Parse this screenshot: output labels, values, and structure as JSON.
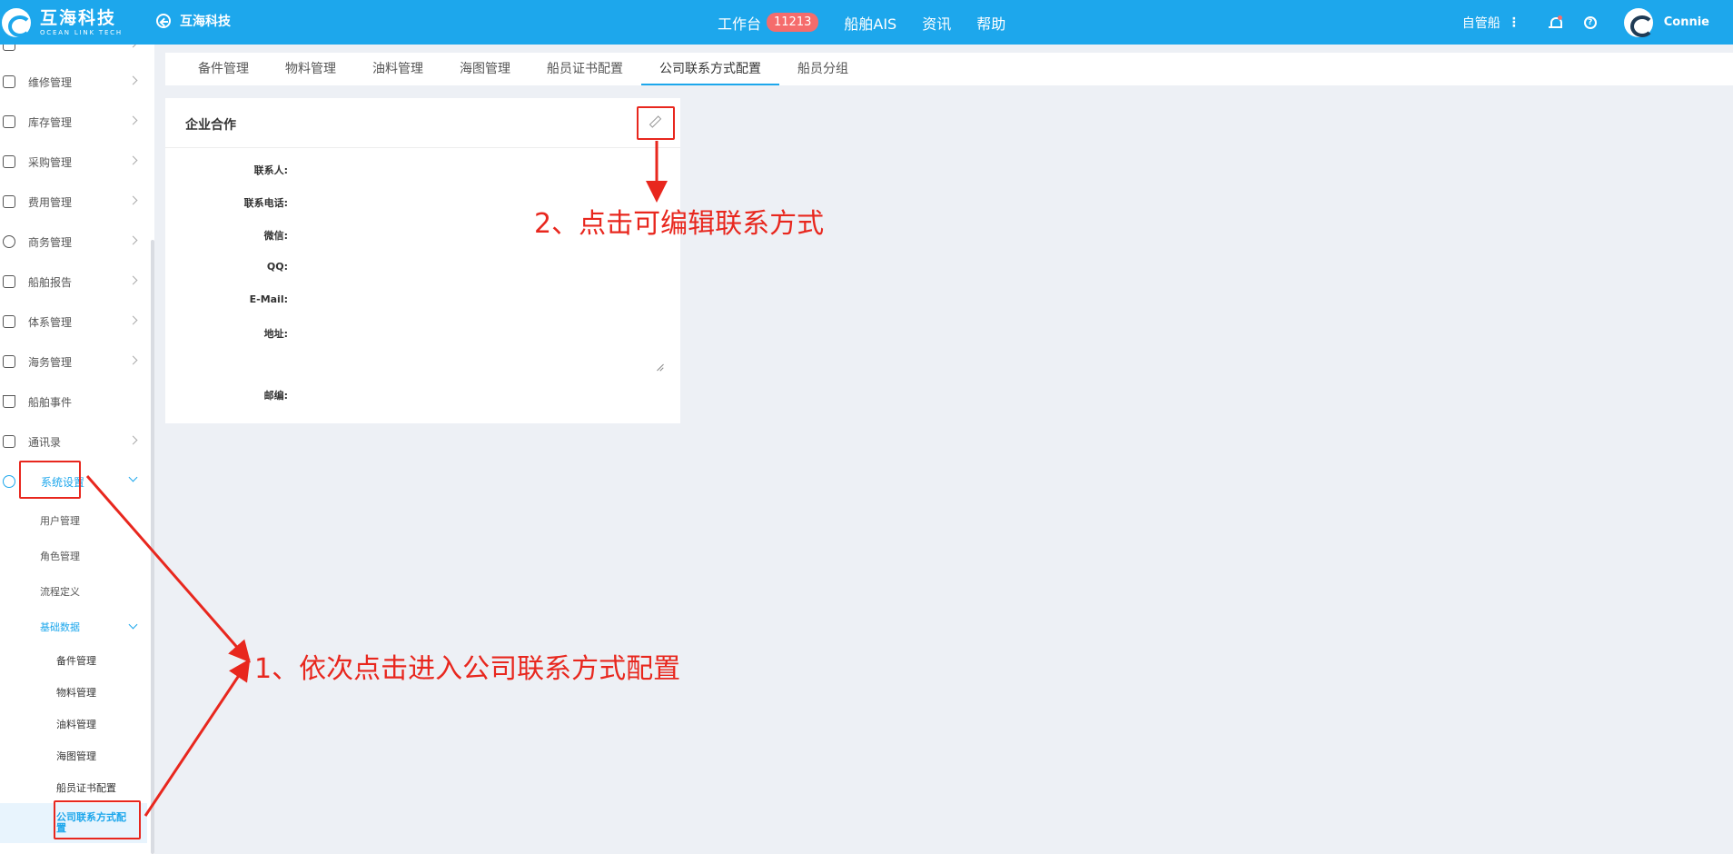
{
  "header": {
    "logo_cn": "互海科技",
    "logo_en": "OCEAN LINK TECH",
    "back_label": "互海科技",
    "nav": [
      {
        "label": "工作台",
        "badge": "11213"
      },
      {
        "label": "船舶AIS"
      },
      {
        "label": "资讯"
      },
      {
        "label": "帮助"
      }
    ],
    "ship_label": "自管船",
    "username": "Connie",
    "accent_color": "#1da7ec"
  },
  "sidebar": {
    "items": [
      {
        "label": "维修管理",
        "icon": "wrench-icon"
      },
      {
        "label": "库存管理",
        "icon": "home-icon"
      },
      {
        "label": "采购管理",
        "icon": "cart-icon"
      },
      {
        "label": "费用管理",
        "icon": "database-icon"
      },
      {
        "label": "商务管理",
        "icon": "globe-icon"
      },
      {
        "label": "船舶报告",
        "icon": "calendar-icon"
      },
      {
        "label": "体系管理",
        "icon": "copy-icon"
      },
      {
        "label": "海务管理",
        "icon": "signpost-icon"
      },
      {
        "label": "船舶事件",
        "icon": "warning-icon"
      },
      {
        "label": "通讯录",
        "icon": "address-book-icon"
      },
      {
        "label": "系统设置",
        "icon": "gear-icon"
      }
    ],
    "system_settings_children": [
      "用户管理",
      "角色管理",
      "流程定义",
      "基础数据"
    ],
    "basic_data_children": [
      "备件管理",
      "物料管理",
      "油料管理",
      "海图管理",
      "船员证书配置",
      "公司联系方式配置"
    ]
  },
  "tabs": [
    "备件管理",
    "物料管理",
    "油料管理",
    "海图管理",
    "船员证书配置",
    "公司联系方式配置",
    "船员分组"
  ],
  "active_tab": "公司联系方式配置",
  "card": {
    "title": "企业合作",
    "fields": [
      "联系人:",
      "联系电话:",
      "微信:",
      "QQ:",
      "E-Mail:",
      "地址:",
      "邮编:"
    ]
  },
  "annotations": {
    "step1": "1、依次点击进入公司联系方式配置",
    "step2": "2、点击可编辑联系方式",
    "color": "#e8271e"
  }
}
